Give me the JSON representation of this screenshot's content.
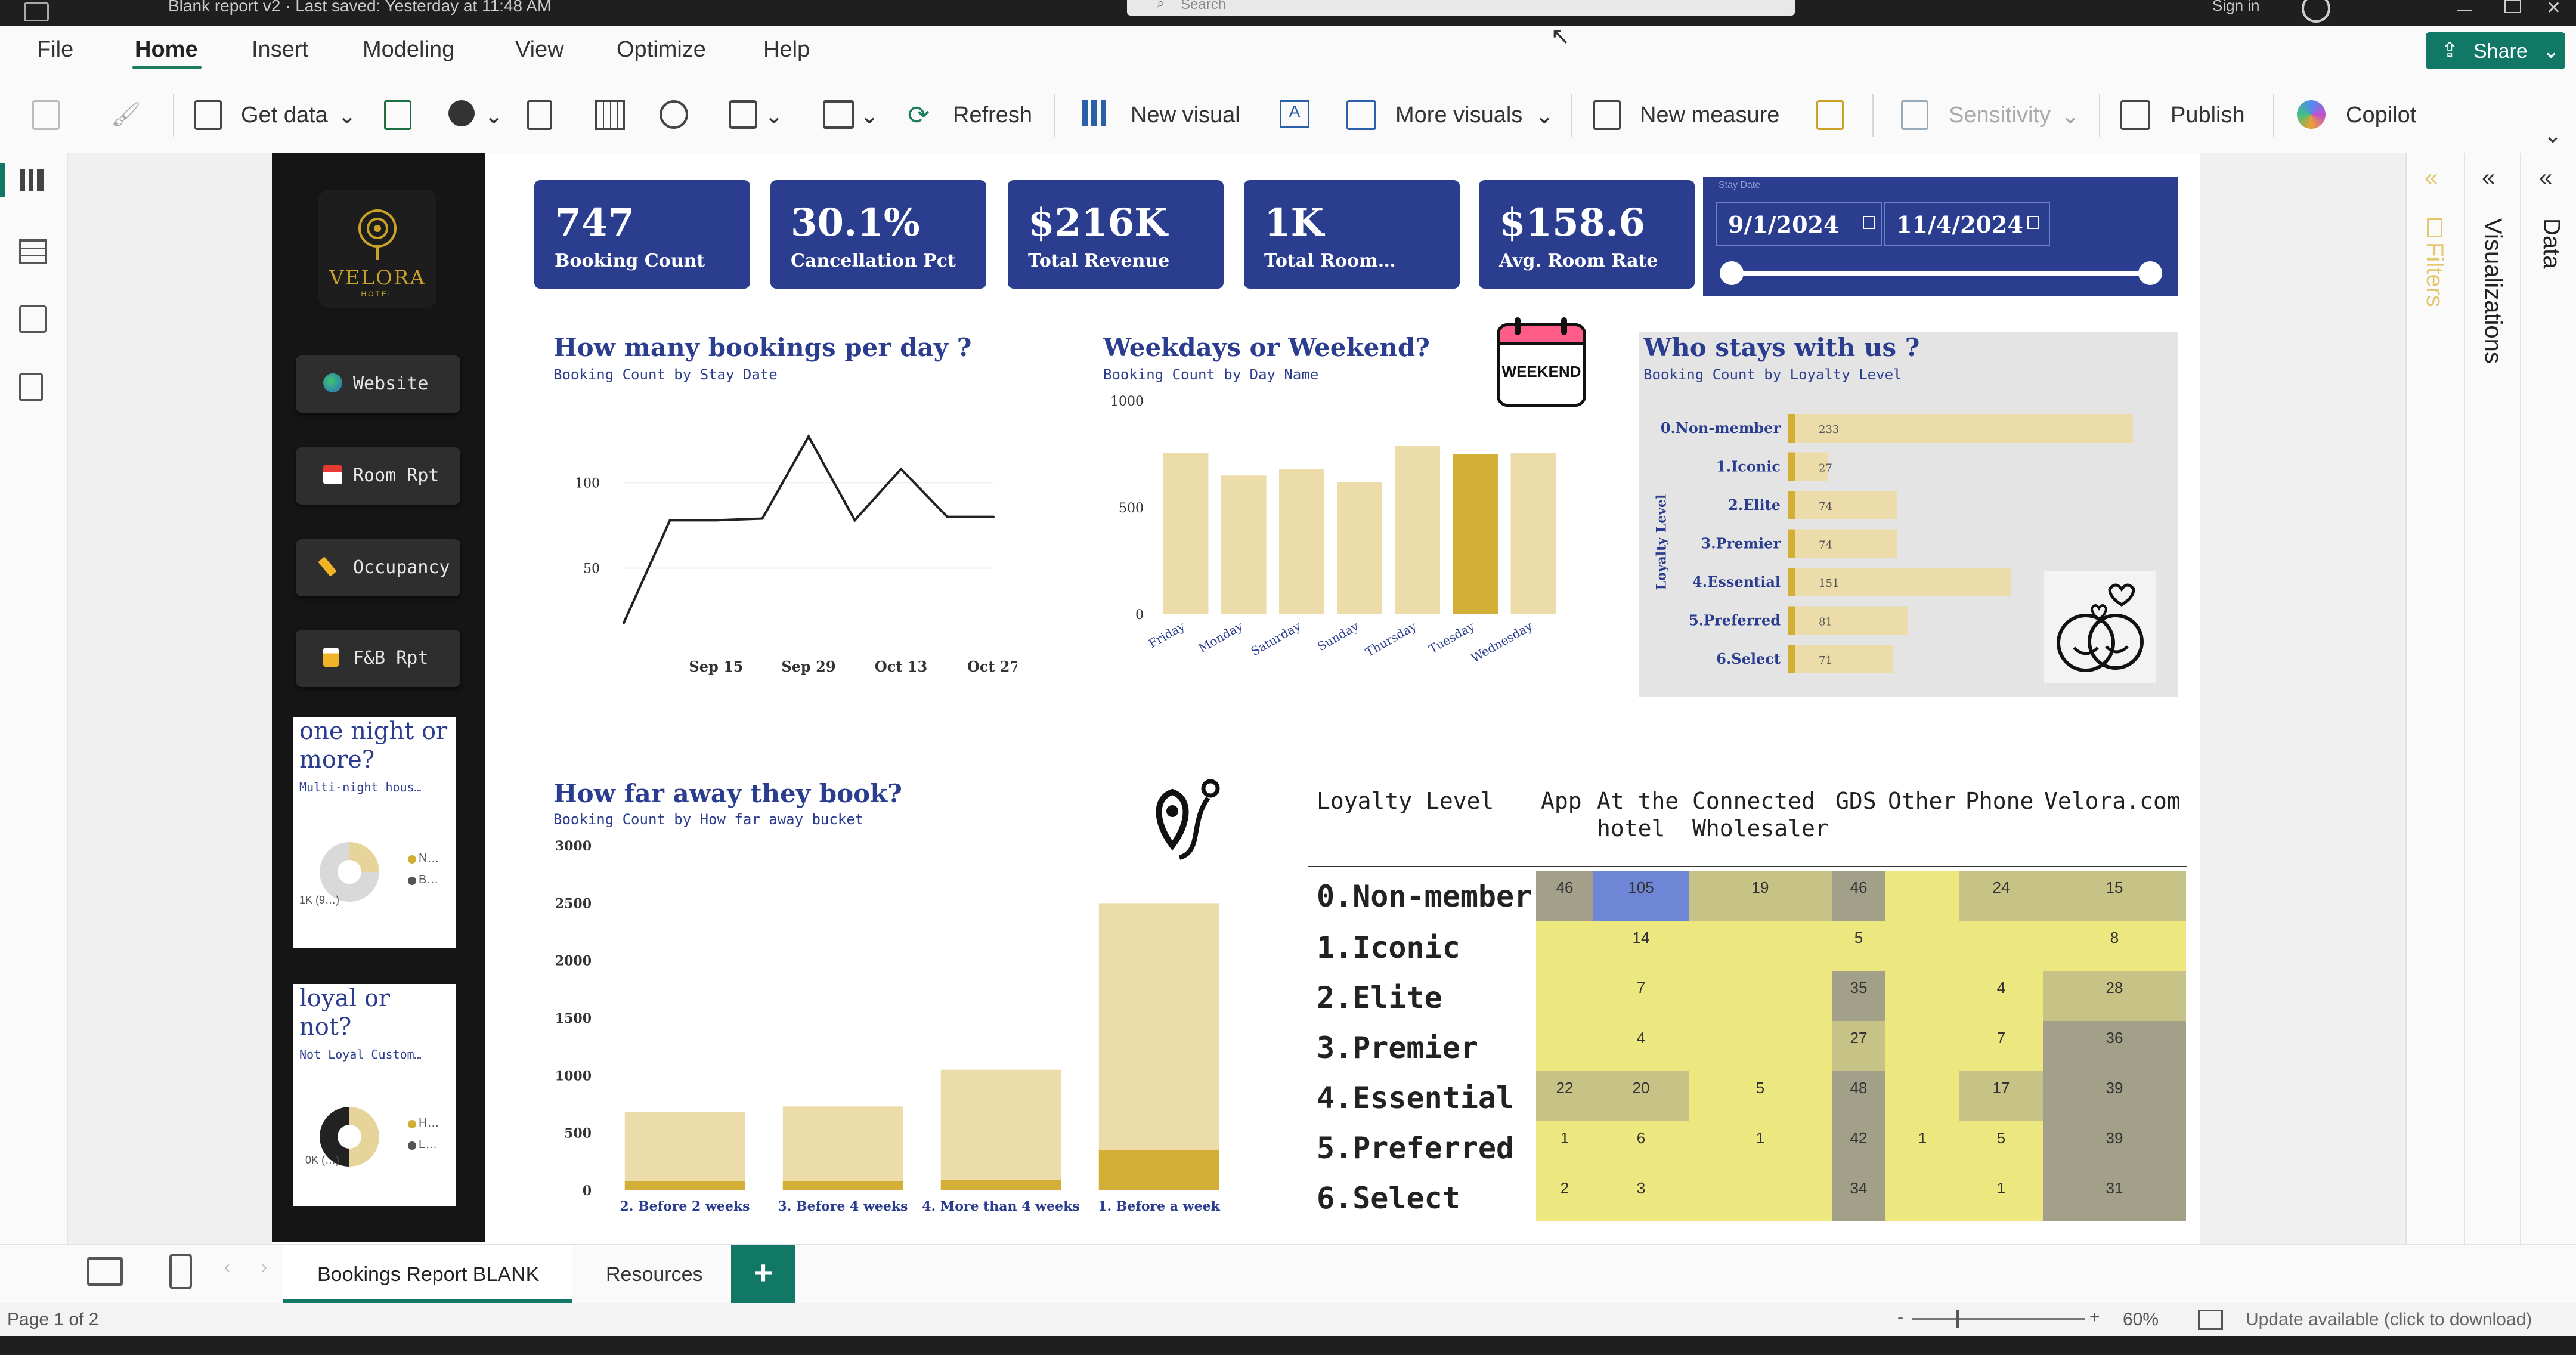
{
  "app": {
    "title": "Blank report v2 · Last saved: Yesterday at 11:48 AM",
    "search_placeholder": "Search",
    "sign_in": "Sign in"
  },
  "menu": {
    "items": [
      "File",
      "Home",
      "Insert",
      "Modeling",
      "View",
      "Optimize",
      "Help"
    ],
    "active": "Home",
    "share_label": "Share"
  },
  "ribbon": {
    "get_data": "Get data",
    "refresh": "Refresh",
    "new_visual": "New visual",
    "more_visuals": "More visuals",
    "new_measure": "New measure",
    "sensitivity": "Sensitivity",
    "publish": "Publish",
    "copilot": "Copilot"
  },
  "sidebar": {
    "logo": "VELORA",
    "logo_sub": "HOTEL",
    "buttons": [
      {
        "label": "Website",
        "icon": "globe-icon"
      },
      {
        "label": "Room Rpt",
        "icon": "calendar-icon"
      },
      {
        "label": "Occupancy",
        "icon": "key-icon"
      },
      {
        "label": "F&B Rpt",
        "icon": "beer-icon"
      }
    ],
    "mini1": {
      "title": "one night or more?",
      "sub": "Multi-night hous…",
      "legend": [
        "N…",
        "B…"
      ],
      "label": "1K (9…)"
    },
    "mini2": {
      "title": "loyal or not?",
      "sub": "Not Loyal Custom…",
      "legend": [
        "H…",
        "L…"
      ],
      "label": "0K (…)"
    }
  },
  "kpis": [
    {
      "value": "747",
      "label": "Booking Count"
    },
    {
      "value": "30.1%",
      "label": "Cancellation Pct"
    },
    {
      "value": "$216K",
      "label": "Total Revenue"
    },
    {
      "value": "1K",
      "label": "Total Room…"
    },
    {
      "value": "$158.6",
      "label": "Avg. Room Rate"
    }
  ],
  "date_slicer": {
    "label": "Stay Date",
    "start": "9/1/2024",
    "end": "11/4/2024",
    "start_frac": 0,
    "end_frac": 1
  },
  "chart_data": [
    {
      "type": "line",
      "title": "How many bookings per day ?",
      "subtitle": "Booking Count by Stay Date",
      "x": [
        "Sep 8",
        "Sep 11",
        "Sep 15",
        "Sep 22",
        "Sep 29",
        "Oct 6",
        "Oct 13",
        "Oct 20",
        "Oct 27"
      ],
      "values": [
        18,
        78,
        78,
        79,
        127,
        78,
        108,
        80,
        80
      ],
      "xticks": [
        "Sep 15",
        "Sep 29",
        "Oct 13",
        "Oct 27"
      ],
      "yticks": [
        "100",
        "50"
      ],
      "ylim": [
        0,
        150
      ]
    },
    {
      "type": "bar",
      "title": "Weekdays or Weekend?",
      "subtitle": "Booking Count by Day Name",
      "categories": [
        "Friday",
        "Monday",
        "Saturday",
        "Sunday",
        "Thursday",
        "Tuesday",
        "Wednesday"
      ],
      "values": [
        755,
        650,
        680,
        620,
        790,
        750,
        755
      ],
      "highlight": "Tuesday",
      "yticks": [
        "1000",
        "500",
        "0"
      ],
      "ylim": [
        0,
        1000
      ],
      "badge": "WEEKEND"
    },
    {
      "type": "bar",
      "orientation": "horizontal",
      "title": "Who stays with us ?",
      "subtitle": "Booking Count by Loyalty Level",
      "ylabel": "Loyalty Level",
      "categories": [
        "0.Non-member",
        "1.Iconic",
        "2.Elite",
        "3.Premier",
        "4.Essential",
        "5.Preferred",
        "6.Select"
      ],
      "values": [
        233,
        27,
        74,
        74,
        151,
        81,
        71
      ],
      "labels": [
        "233",
        "27",
        "74",
        "74",
        "151",
        "81",
        "71"
      ],
      "xlim": [
        0,
        240
      ]
    },
    {
      "type": "bar",
      "title": "How far away they book?",
      "subtitle": "Booking Count by How far away bucket",
      "categories": [
        "2. Before 2 weeks",
        "3. Before 4 weeks",
        "4. More than 4 weeks",
        "1. Before a week"
      ],
      "series": [
        {
          "values": [
            680,
            730,
            1050,
            2500
          ]
        },
        {
          "values": [
            80,
            80,
            90,
            350
          ]
        }
      ],
      "yticks": [
        "3000",
        "2500",
        "2000",
        "1500",
        "1000",
        "500",
        "0"
      ],
      "ylim": [
        0,
        3000
      ]
    }
  ],
  "matrix": {
    "headers": [
      "Loyalty Level",
      "App",
      "At the hotel",
      "Connected Wholesaler",
      "GDS",
      "Other",
      "Phone",
      "Velora.com"
    ],
    "rows": [
      {
        "label": "0.Non-member",
        "cells": [
          "46",
          "105",
          "19",
          "46",
          "",
          "24",
          "15"
        ]
      },
      {
        "label": "1.Iconic",
        "cells": [
          "",
          "14",
          "",
          "5",
          "",
          "",
          "8"
        ]
      },
      {
        "label": "2.Elite",
        "cells": [
          "",
          "7",
          "",
          "35",
          "",
          "4",
          "28"
        ]
      },
      {
        "label": "3.Premier",
        "cells": [
          "",
          "4",
          "",
          "27",
          "",
          "7",
          "36"
        ]
      },
      {
        "label": "4.Essential",
        "cells": [
          "22",
          "20",
          "5",
          "48",
          "",
          "17",
          "39"
        ]
      },
      {
        "label": "5.Preferred",
        "cells": [
          "1",
          "6",
          "1",
          "42",
          "1",
          "5",
          "39"
        ]
      },
      {
        "label": "6.Select",
        "cells": [
          "2",
          "3",
          "",
          "34",
          "",
          "1",
          "31"
        ]
      }
    ]
  },
  "right_panes": {
    "filters": "Filters",
    "visualizations": "Visualizations",
    "data": "Data"
  },
  "tabs": {
    "items": [
      "Bookings Report BLANK",
      "Resources"
    ],
    "active": "Bookings Report BLANK",
    "add": "+"
  },
  "status": {
    "page": "Page 1 of 2",
    "zoom": "60%",
    "update": "Update available (click to download)"
  },
  "colors": {
    "navy": "#2b3d8f",
    "gold": "#d4af37",
    "pale_gold": "#ecdcaa",
    "teal": "#117865"
  }
}
